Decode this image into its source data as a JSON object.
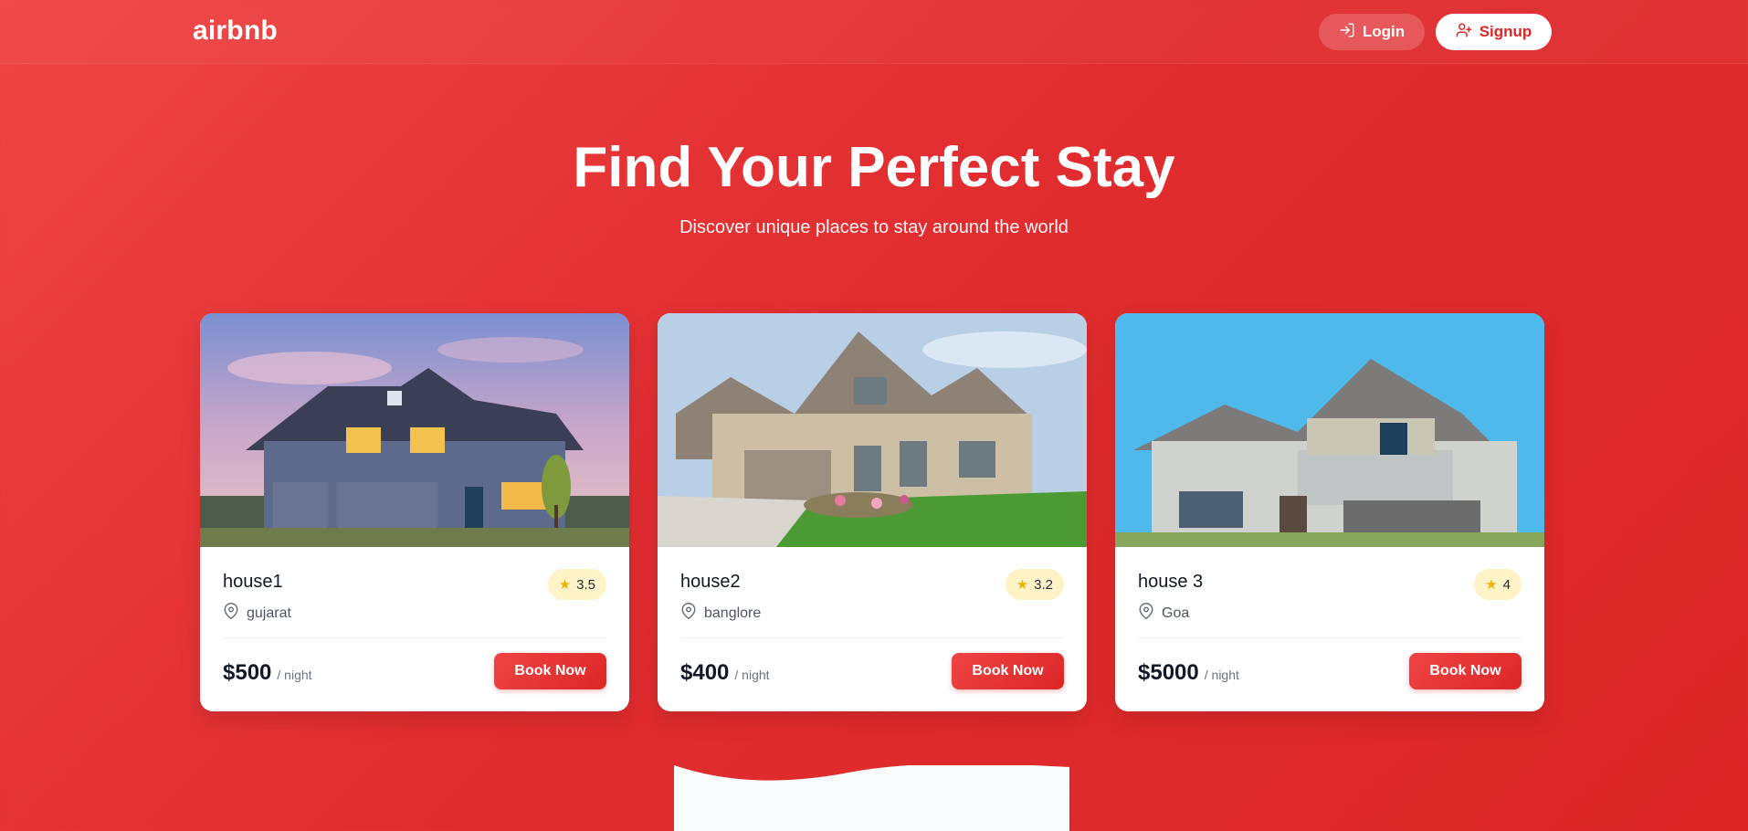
{
  "header": {
    "logo": "airbnb",
    "login_label": "Login",
    "signup_label": "Signup"
  },
  "hero": {
    "title": "Find Your Perfect Stay",
    "subtitle": "Discover unique places to stay around the world"
  },
  "listings": [
    {
      "title": "house1",
      "location": "gujarat",
      "rating": "3.5",
      "price": "$500",
      "per": "/ night",
      "cta": "Book Now"
    },
    {
      "title": "house2",
      "location": "banglore",
      "rating": "3.2",
      "price": "$400",
      "per": "/ night",
      "cta": "Book Now"
    },
    {
      "title": "house 3",
      "location": "Goa",
      "rating": "4",
      "price": "$5000",
      "per": "/ night",
      "cta": "Book Now"
    }
  ],
  "colors": {
    "brand": "#dc2626",
    "rating_bg": "#fef3c7",
    "star": "#eab308"
  },
  "icons": {
    "login": "login-icon",
    "signup": "user-plus-icon",
    "location": "map-pin-icon",
    "rating": "star-icon"
  }
}
